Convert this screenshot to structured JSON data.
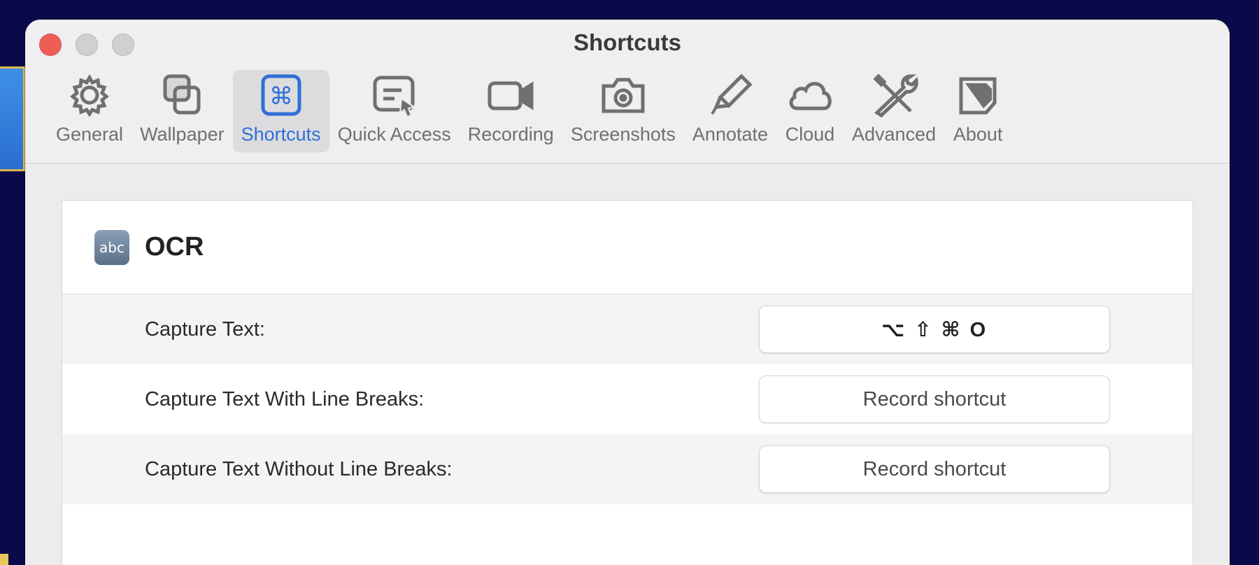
{
  "window": {
    "title": "Shortcuts"
  },
  "tabs": [
    {
      "id": "general",
      "label": "General",
      "icon": "gear-icon"
    },
    {
      "id": "wallpaper",
      "label": "Wallpaper",
      "icon": "wallpaper-icon"
    },
    {
      "id": "shortcuts",
      "label": "Shortcuts",
      "icon": "command-icon",
      "active": true
    },
    {
      "id": "quick-access",
      "label": "Quick Access",
      "icon": "quick-access-icon"
    },
    {
      "id": "recording",
      "label": "Recording",
      "icon": "video-camera-icon"
    },
    {
      "id": "screenshots",
      "label": "Screenshots",
      "icon": "camera-icon"
    },
    {
      "id": "annotate",
      "label": "Annotate",
      "icon": "highlighter-icon"
    },
    {
      "id": "cloud",
      "label": "Cloud",
      "icon": "cloud-icon"
    },
    {
      "id": "advanced",
      "label": "Advanced",
      "icon": "tools-icon"
    },
    {
      "id": "about",
      "label": "About",
      "icon": "about-icon"
    }
  ],
  "section": {
    "icon_text": "abc",
    "title": "OCR",
    "rows": [
      {
        "label": "Capture Text:",
        "shortcut": "⌥ ⇧ ⌘ O"
      },
      {
        "label": "Capture Text With Line Breaks:",
        "shortcut": "Record shortcut"
      },
      {
        "label": "Capture Text Without Line Breaks:",
        "shortcut": "Record shortcut"
      }
    ]
  },
  "colors": {
    "accent": "#2f6fd8",
    "close": "#ee5e57",
    "background": "#0a0a4a"
  }
}
